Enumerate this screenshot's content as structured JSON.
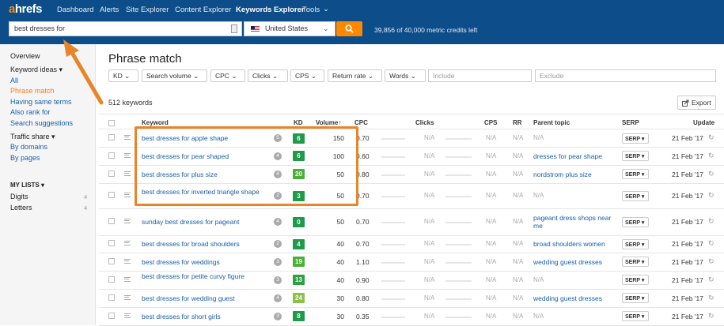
{
  "nav": {
    "logo_a": "a",
    "logo_rest": "hrefs",
    "items": [
      "Dashboard",
      "Alerts",
      "Site Explorer",
      "Content Explorer",
      "Keywords Explorer",
      "Tools"
    ]
  },
  "search": {
    "query": "best dresses for",
    "country": "United States",
    "credits": "39,856 of 40,000 metric credits left"
  },
  "sidebar": {
    "overview": "Overview",
    "keyword_ideas": "Keyword ideas",
    "items": [
      "All",
      "Phrase match",
      "Having same terms",
      "Also rank for",
      "Search suggestions"
    ],
    "traffic_share": "Traffic share",
    "traffic_items": [
      "By domains",
      "By pages"
    ],
    "my_lists": "MY LISTS",
    "lists": [
      {
        "name": "Digits",
        "count": "4"
      },
      {
        "name": "Letters",
        "count": "4"
      }
    ]
  },
  "main": {
    "title": "Phrase match",
    "filters": [
      "KD",
      "Search volume",
      "CPC",
      "Clicks",
      "CPS",
      "Return rate",
      "Words"
    ],
    "include_placeholder": "Include",
    "exclude_placeholder": "Exclude",
    "keyword_count": "512 keywords",
    "export_label": "Export",
    "columns": [
      "Keyword",
      "KD",
      "Volume",
      "CPC",
      "Clicks",
      "CPS",
      "RR",
      "Parent topic",
      "SERP",
      "Update"
    ]
  },
  "rows": [
    {
      "keyword": "best dresses for apple shape",
      "badge": "5",
      "kd": "6",
      "kd_color": "#1e9a48",
      "volume": "150",
      "cpc": "0.70",
      "clicks": "N/A",
      "cps": "N/A",
      "rr": "N/A",
      "parent": "N/A",
      "serp": "SERP",
      "date": "21 Feb '17"
    },
    {
      "keyword": "best dresses for pear shaped",
      "badge": "4",
      "kd": "6",
      "kd_color": "#1e9a48",
      "volume": "100",
      "cpc": "0.60",
      "clicks": "N/A",
      "cps": "N/A",
      "rr": "N/A",
      "parent": "dresses for pear shape",
      "serp": "SERP",
      "date": "21 Feb '17"
    },
    {
      "keyword": "best dresses for plus size",
      "badge": "4",
      "kd": "20",
      "kd_color": "#4caf3a",
      "volume": "50",
      "cpc": "0.80",
      "clicks": "N/A",
      "cps": "N/A",
      "rr": "N/A",
      "parent": "nordstrom plus size",
      "serp": "SERP",
      "date": "21 Feb '17"
    },
    {
      "keyword": "best dresses for inverted triangle shape",
      "badge": "2",
      "kd": "3",
      "kd_color": "#1e9a48",
      "volume": "50",
      "cpc": "0.70",
      "clicks": "N/A",
      "cps": "N/A",
      "rr": "N/A",
      "parent": "N/A",
      "serp": "SERP",
      "date": "21 Feb '17"
    },
    {
      "keyword": "sunday best dresses for pageant",
      "badge": "4",
      "kd": "0",
      "kd_color": "#1e9a48",
      "volume": "50",
      "cpc": "0.70",
      "clicks": "N/A",
      "cps": "N/A",
      "rr": "N/A",
      "parent": "pageant dress shops near me",
      "serp": "SERP",
      "date": "21 Feb '17"
    },
    {
      "keyword": "best dresses for broad shoulders",
      "badge": "2",
      "kd": "4",
      "kd_color": "#1e9a48",
      "volume": "40",
      "cpc": "0.70",
      "clicks": "N/A",
      "cps": "N/A",
      "rr": "N/A",
      "parent": "broad shoulders women",
      "serp": "SERP",
      "date": "21 Feb '17"
    },
    {
      "keyword": "best dresses for weddings",
      "badge": "3",
      "kd": "19",
      "kd_color": "#4caf3a",
      "volume": "40",
      "cpc": "1.10",
      "clicks": "N/A",
      "cps": "N/A",
      "rr": "N/A",
      "parent": "wedding guest dresses",
      "serp": "SERP",
      "date": "21 Feb '17"
    },
    {
      "keyword": "best dresses for petite curvy figure",
      "badge": "3",
      "kd": "13",
      "kd_color": "#2ea043",
      "volume": "40",
      "cpc": "0.90",
      "clicks": "N/A",
      "cps": "N/A",
      "rr": "N/A",
      "parent": "N/A",
      "serp": "SERP",
      "date": "21 Feb '17"
    },
    {
      "keyword": "best dresses for wedding guest",
      "badge": "4",
      "kd": "24",
      "kd_color": "#8bc34a",
      "volume": "30",
      "cpc": "0.80",
      "clicks": "N/A",
      "cps": "N/A",
      "rr": "N/A",
      "parent": "wedding guest dresses",
      "serp": "SERP",
      "date": "21 Feb '17"
    },
    {
      "keyword": "best dresses for short girls",
      "badge": "3",
      "kd": "8",
      "kd_color": "#1e9a48",
      "volume": "30",
      "cpc": "0.35",
      "clicks": "N/A",
      "cps": "N/A",
      "rr": "N/A",
      "parent": "N/A",
      "serp": "SERP",
      "date": "21 Feb '17"
    }
  ],
  "colors": {
    "nav_bg": "#0d4d8a",
    "accent": "#ff8800",
    "link": "#1a5fa7",
    "annotation": "#e8842a"
  }
}
